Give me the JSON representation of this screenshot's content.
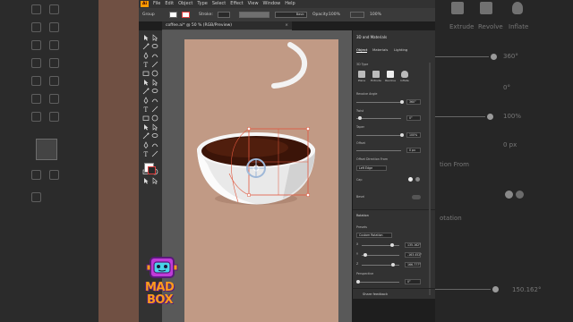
{
  "app": {
    "logo": "Ai",
    "menu": [
      "File",
      "Edit",
      "Object",
      "Type",
      "Select",
      "Effect",
      "View",
      "Window",
      "Help"
    ]
  },
  "controlbar": {
    "selection": "Group",
    "stroke_label": "Stroke:",
    "stroke_style": "Basic",
    "opacity_label": "Opacity:",
    "opacity_value": "100%",
    "percent": "100%"
  },
  "document": {
    "tab_title": "coffee.ai* @ 50 % (RGB/Preview)",
    "close": "×"
  },
  "panel": {
    "title": "3D and Materials",
    "tabs": [
      "Object",
      "Materials",
      "Lighting"
    ],
    "section_3d_type": "3D Type",
    "types": [
      "Plane",
      "Extrude",
      "Revolve",
      "Inflate"
    ],
    "revolve_angle_label": "Revolve Angle",
    "revolve_angle_value": "360°",
    "twist_label": "Twist",
    "twist_value": "0°",
    "taper_label": "Taper",
    "taper_value": "100%",
    "offset_label": "Offset",
    "offset_value": "0 px",
    "offset_direction_label": "Offset Direction From",
    "offset_direction_value": "Left Edge",
    "cap_label": "Cap",
    "bevel_label": "Bevel",
    "rotation_label": "Rotation",
    "presets_label": "Presets",
    "presets_value": "Custom Rotation",
    "x_label": "X",
    "x_value": "135.162°",
    "y_label": "Y",
    "y_value": "-163.452°",
    "z_label": "Z",
    "z_value": "166.777°",
    "perspective_label": "Perspective",
    "perspective_value": "0°",
    "feedback": "Share feedback"
  },
  "background_right": {
    "types": [
      "Extrude",
      "Revolve",
      "Inflate"
    ],
    "values": [
      "360°",
      "0°",
      "100%",
      "0 px"
    ],
    "label_from": "tion From",
    "label_rotation": "otation",
    "bottom_value": "150.162°"
  },
  "logo_text": [
    "MAD",
    "BOX"
  ],
  "colors": {
    "accent_orange": "#ff9a00",
    "artboard": "#c19a85",
    "coffee": "#4a1a0a",
    "selection": "#e0563c"
  }
}
